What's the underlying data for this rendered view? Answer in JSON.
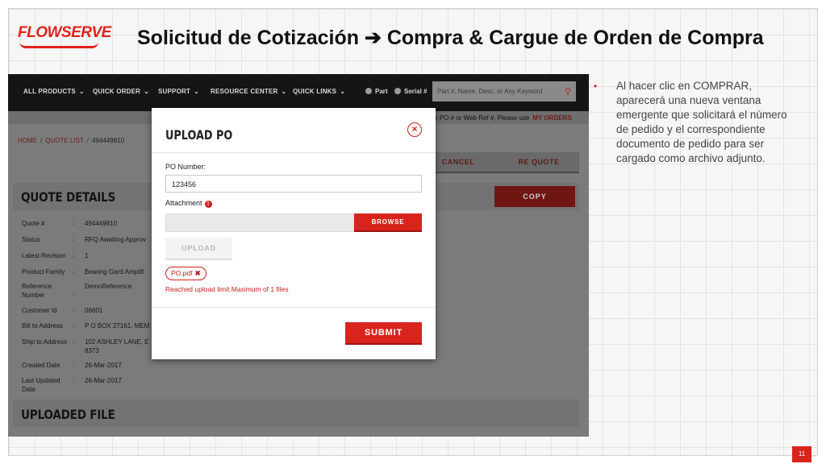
{
  "slide": {
    "logo_text": "FLOWSERVE",
    "title": "Solicitud de Cotización ➔ Compra & Cargue de Orden de Compra",
    "note": "Al hacer clic en COMPRAR, aparecerá una nueva ventana emergente que solicitará el número de pedido y el correspondiente documento de pedido para ser cargado como archivo adjunto.",
    "bullet": "•",
    "page_number": "11"
  },
  "nav": {
    "items": [
      "ALL PRODUCTS",
      "QUICK ORDER",
      "SUPPORT",
      "RESOURCE CENTER",
      "QUICK LINKS"
    ],
    "radio_part": "Part",
    "radio_serial": "Serial #",
    "search_placeholder": "Part #, Name, Desc. or Any Keyword",
    "subbar_text": "r PO # or Web Ref #, Please use",
    "subbar_link": "MY ORDERS"
  },
  "breadcrumb": {
    "home": "HOME",
    "quote_list": "QUOTE LIST",
    "current": "494449810",
    "sep": "/"
  },
  "actions": {
    "cancel": "CANCEL",
    "requote": "RE QUOTE",
    "copy": "COPY"
  },
  "quote_details": {
    "title": "QUOTE DETAILS",
    "rows": [
      {
        "label": "Quote #",
        "value": "494449810"
      },
      {
        "label": "Status",
        "value": "RFQ Awaiting Approv"
      },
      {
        "label": "Latest Revision",
        "value": "1"
      },
      {
        "label": "Product Family",
        "value": "Bearing Gard:Amplifi"
      },
      {
        "label": "Reference Number",
        "value": "DemoReference"
      },
      {
        "label": "Customer Id",
        "value": "06601"
      },
      {
        "label": "Bill to Address",
        "value": "P O BOX 27161, MEM"
      },
      {
        "label": "Ship to Address",
        "value": "102 ASHLEY LANE, E"
      },
      {
        "label": "Created Date",
        "value": "26-Mar-2017"
      },
      {
        "label": "Last Updated Date",
        "value": "26-Mar-2017"
      }
    ],
    "ship_extra": "8373",
    "colon": ":"
  },
  "uploaded_file": {
    "title": "UPLOADED FILE"
  },
  "modal": {
    "title": "UPLOAD PO",
    "close_glyph": "×",
    "po_label": "PO Number:",
    "po_value": "123456",
    "attachment_label": "Attachment",
    "info_glyph": "!",
    "browse": "BROWSE",
    "upload": "UPLOAD",
    "file_name": "PO.pdf",
    "file_remove_glyph": "✖",
    "limit_message": "Reached upload limit.Maximum of 1 files",
    "submit": "SUBMIT"
  },
  "colors": {
    "brand_red": "#d8241d",
    "nav_bg": "#151515"
  }
}
